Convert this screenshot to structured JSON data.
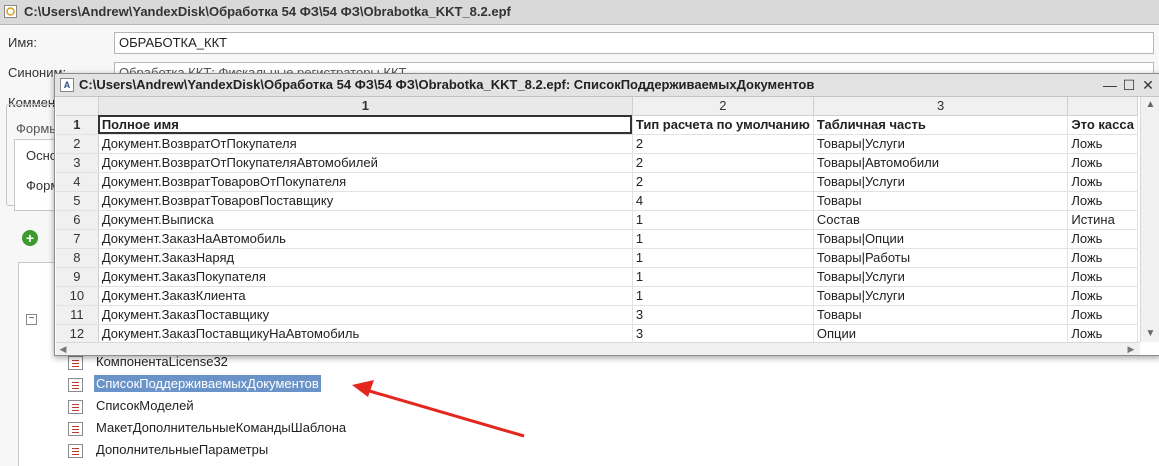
{
  "main_window": {
    "title": "C:\\Users\\Andrew\\YandexDisk\\Обработка 54 ФЗ\\54 ФЗ\\Obrabotka_KKT_8.2.epf"
  },
  "form": {
    "name_label": "Имя:",
    "name_value": "ОБРАБОТКА_ККТ",
    "synonym_label": "Синоним:",
    "synonym_value": "Обработка ККТ: Фискальные регистраторы ККТ",
    "comment_label": "Комментарий:",
    "forms_group_label": "Формы",
    "tab_main_label": "Основная",
    "tab_form_label": "Форма"
  },
  "tree": {
    "items": [
      {
        "label": "КомпонентаLicense32",
        "selected": false
      },
      {
        "label": "СписокПоддерживаемыхДокументов",
        "selected": true
      },
      {
        "label": "СписокМоделей",
        "selected": false
      },
      {
        "label": "МакетДополнительныеКомандыШаблона",
        "selected": false
      },
      {
        "label": "ДополнительныеПараметры",
        "selected": false
      }
    ]
  },
  "table_window": {
    "title": "C:\\Users\\Andrew\\YandexDisk\\Обработка 54 ФЗ\\54 ФЗ\\Obrabotka_KKT_8.2.epf: СписокПоддерживаемыхДокументов",
    "minimize_glyph": "—",
    "maximize_glyph": "☐",
    "close_glyph": "✕",
    "column_numbers": [
      "1",
      "2",
      "3",
      ""
    ],
    "rows": [
      {
        "n": "1",
        "c1": "Полное имя",
        "c2": "Тип расчета по умолчанию",
        "c3": "Табличная часть",
        "c4": "Это касса"
      },
      {
        "n": "2",
        "c1": "Документ.ВозвратОтПокупателя",
        "c2": "2",
        "c3": "Товары|Услуги",
        "c4": "Ложь"
      },
      {
        "n": "3",
        "c1": "Документ.ВозвратОтПокупателяАвтомобилей",
        "c2": "2",
        "c3": "Товары|Автомобили",
        "c4": "Ложь"
      },
      {
        "n": "4",
        "c1": "Документ.ВозвратТоваровОтПокупателя",
        "c2": "2",
        "c3": "Товары|Услуги",
        "c4": "Ложь"
      },
      {
        "n": "5",
        "c1": "Документ.ВозвратТоваровПоставщику",
        "c2": "4",
        "c3": "Товары",
        "c4": "Ложь"
      },
      {
        "n": "6",
        "c1": "Документ.Выписка",
        "c2": "1",
        "c3": "Состав",
        "c4": "Истина"
      },
      {
        "n": "7",
        "c1": "Документ.ЗаказНаАвтомобиль",
        "c2": "1",
        "c3": "Товары|Опции",
        "c4": "Ложь"
      },
      {
        "n": "8",
        "c1": "Документ.ЗаказНаряд",
        "c2": "1",
        "c3": "Товары|Работы",
        "c4": "Ложь"
      },
      {
        "n": "9",
        "c1": "Документ.ЗаказПокупателя",
        "c2": "1",
        "c3": "Товары|Услуги",
        "c4": "Ложь"
      },
      {
        "n": "10",
        "c1": "Документ.ЗаказКлиента",
        "c2": "1",
        "c3": "Товары|Услуги",
        "c4": "Ложь"
      },
      {
        "n": "11",
        "c1": "Документ.ЗаказПоставщику",
        "c2": "3",
        "c3": "Товары",
        "c4": "Ложь"
      },
      {
        "n": "12",
        "c1": "Документ.ЗаказПоставщикуНаАвтомобиль",
        "c2": "3",
        "c3": "Опции",
        "c4": "Ложь"
      }
    ]
  },
  "icons": {
    "add": "add-icon",
    "collapse": "collapse-icon",
    "tree_item": "template-icon"
  },
  "colors": {
    "selection": "#6a93c9",
    "arrow": "#e5261f",
    "add_icon": "#3d9a2c"
  }
}
